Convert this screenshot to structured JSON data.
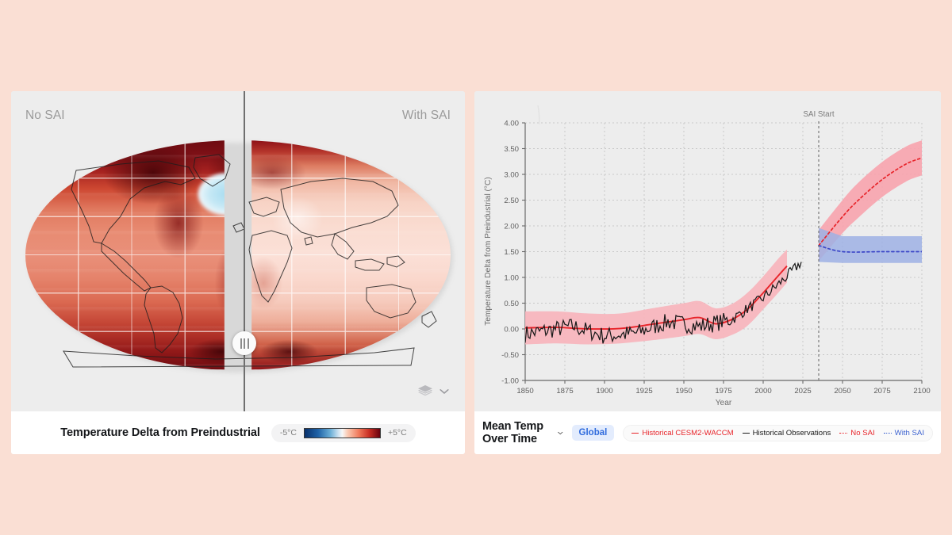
{
  "theme": {
    "page_background": "#fadfd4",
    "panel_background": "#ededed",
    "bar_background": "#ffffff",
    "accent_blue": "#2f6bdd",
    "no_sai_color": "#e8242a",
    "with_sai_color": "#3d63d0",
    "observations_color": "#1a1a1a"
  },
  "map_panel": {
    "left_scenario_label": "No SAI",
    "right_scenario_label": "With SAI",
    "legend_title": "Temperature Delta from Preindustrial",
    "colorbar": {
      "min_label": "-5°C",
      "max_label": "+5°C",
      "ramp": [
        "#08306b",
        "#1f63a8",
        "#6aaed6",
        "#cfe3f2",
        "#f7f7f7",
        "#fbcbb4",
        "#f0795b",
        "#c72d23",
        "#67000d"
      ]
    },
    "layers_icon": "layers-icon",
    "layers_chevron_icon": "chevron-down-icon",
    "swipe_handle_icon": "drag-handle-icon"
  },
  "chart_panel": {
    "menu_title": "Mean Temp Over Time",
    "menu_chevron_icon": "chevron-down-icon",
    "scope_pill": "Global",
    "legend": [
      {
        "label": "Historical CESM2-WACCM",
        "color": "#e8242a",
        "style": "solid"
      },
      {
        "label": "Historical Observations",
        "color": "#1a1a1a",
        "style": "solid"
      },
      {
        "label": "No SAI",
        "color": "#e8242a",
        "style": "dotted"
      },
      {
        "label": "With SAI",
        "color": "#3d63d0",
        "style": "dotted"
      }
    ]
  },
  "chart_data": {
    "type": "line",
    "title": "Mean Temp Over Time",
    "xlabel": "Year",
    "ylabel": "Temperature Delta from Preindustrial (°C)",
    "xlim": [
      1850,
      2100
    ],
    "ylim": [
      -1.0,
      4.0
    ],
    "xticks": [
      1850,
      1875,
      1900,
      1925,
      1950,
      1975,
      2000,
      2025,
      2050,
      2075,
      2100
    ],
    "yticks": [
      "-1.00",
      "-0.50",
      "0.00",
      "0.50",
      "1.00",
      "1.50",
      "2.00",
      "2.50",
      "3.00",
      "3.50",
      "4.00"
    ],
    "grid": true,
    "legend_position": "bottom-bar",
    "annotations": [
      {
        "label": "SAI Start",
        "x": 2035,
        "style": "vertical-dashed-line"
      }
    ],
    "series": [
      {
        "name": "Historical CESM2-WACCM",
        "color": "#e8242a",
        "style": "solid",
        "x": [
          1850,
          1870,
          1890,
          1910,
          1930,
          1950,
          1960,
          1970,
          1980,
          1990,
          2000,
          2010,
          2015
        ],
        "values": [
          0.02,
          0.03,
          0.0,
          0.01,
          0.09,
          0.18,
          0.22,
          0.1,
          0.18,
          0.38,
          0.7,
          1.05,
          1.22
        ],
        "band_low": [
          -0.3,
          -0.28,
          -0.3,
          -0.28,
          -0.22,
          -0.14,
          -0.1,
          -0.2,
          -0.12,
          0.06,
          0.38,
          0.72,
          0.9
        ],
        "band_high": [
          0.34,
          0.34,
          0.3,
          0.3,
          0.4,
          0.5,
          0.54,
          0.4,
          0.48,
          0.7,
          1.02,
          1.38,
          1.54
        ]
      },
      {
        "name": "Historical Observations",
        "color": "#1a1a1a",
        "style": "solid-jagged",
        "x": [
          1850,
          1880,
          1900,
          1920,
          1940,
          1960,
          1980,
          2000,
          2015,
          2024
        ],
        "values": [
          -0.1,
          0.05,
          -0.14,
          -0.08,
          0.14,
          0.05,
          0.18,
          0.6,
          1.02,
          1.3
        ]
      },
      {
        "name": "No SAI",
        "color": "#e8242a",
        "style": "dotted",
        "x": [
          2035,
          2050,
          2060,
          2075,
          2090,
          2100
        ],
        "values": [
          1.62,
          2.18,
          2.5,
          2.9,
          3.2,
          3.32
        ],
        "band_low": [
          1.32,
          1.86,
          2.16,
          2.56,
          2.86,
          2.98
        ],
        "band_high": [
          1.92,
          2.5,
          2.84,
          3.24,
          3.54,
          3.66
        ]
      },
      {
        "name": "With SAI",
        "color": "#3d63d0",
        "style": "dotted",
        "x": [
          2035,
          2050,
          2075,
          2100
        ],
        "values": [
          1.62,
          1.5,
          1.5,
          1.5
        ],
        "band_low": [
          1.3,
          1.28,
          1.28,
          1.28
        ],
        "band_high": [
          1.96,
          1.8,
          1.8,
          1.8
        ]
      }
    ]
  }
}
